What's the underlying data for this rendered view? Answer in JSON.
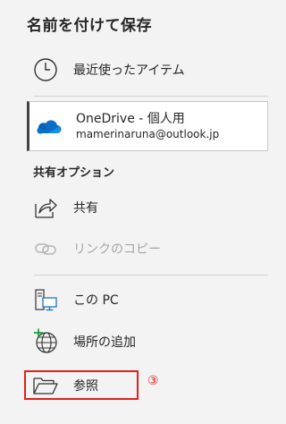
{
  "title": "名前を付けて保存",
  "recent": {
    "label": "最近使ったアイテム",
    "icon": "clock-icon"
  },
  "onedrive": {
    "name": "OneDrive - 個人用",
    "email": "mamerinaruna@outlook.jp",
    "icon": "onedrive-cloud-icon",
    "accent": "#0364b8"
  },
  "share_options": {
    "heading": "共有オプション",
    "share": {
      "label": "共有",
      "icon": "share-icon"
    },
    "copy_link": {
      "label": "リンクのコピー",
      "icon": "link-icon",
      "disabled": true
    }
  },
  "locations": {
    "this_pc": {
      "label": "この PC",
      "icon": "this-pc-icon"
    },
    "add_place": {
      "label": "場所の追加",
      "icon": "add-place-globe-icon"
    },
    "browse": {
      "label": "参照",
      "icon": "folder-open-icon"
    }
  },
  "annotation": {
    "step_marker": "③",
    "color": "#e0201c"
  }
}
